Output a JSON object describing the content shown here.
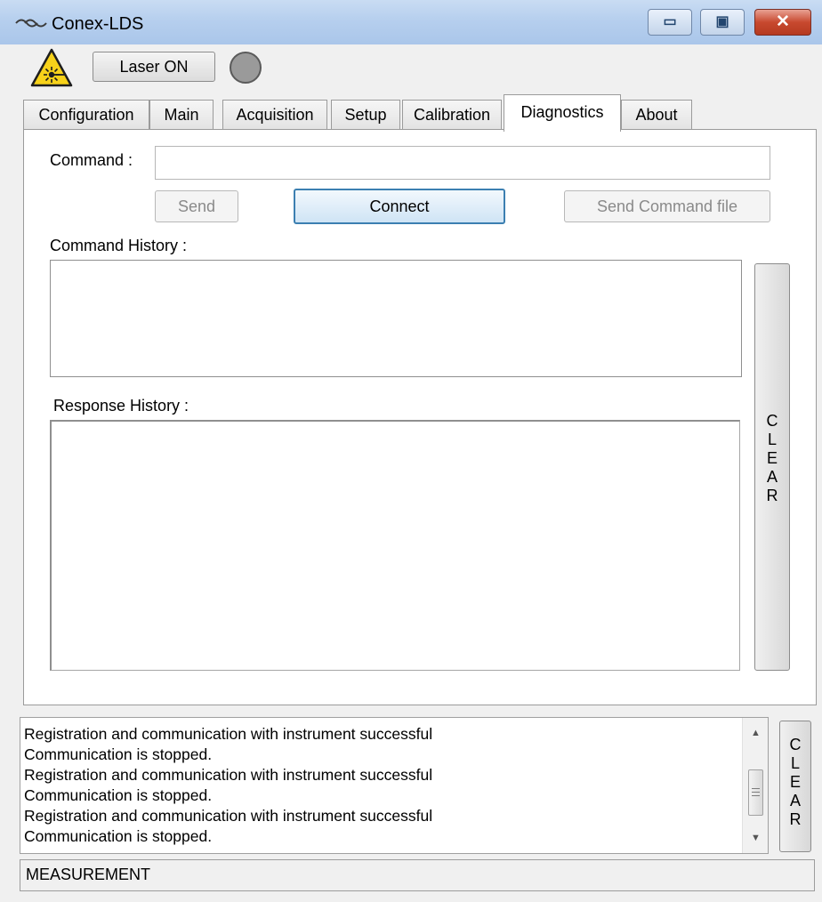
{
  "window": {
    "title": "Conex-LDS",
    "minimize_icon": "minimize-icon",
    "maximize_icon": "maximize-icon",
    "close_icon": "close-icon",
    "minimize_glyph": "▭",
    "maximize_glyph": "▣",
    "close_glyph": "✕"
  },
  "toolbar": {
    "laser_button_label": "Laser ON",
    "laser_icon": "laser-warning-icon",
    "indicator_color": "#9a9a9a"
  },
  "tabs": [
    {
      "label": "Configuration"
    },
    {
      "label": "Main"
    },
    {
      "label": "Acquisition"
    },
    {
      "label": "Setup"
    },
    {
      "label": "Calibration"
    },
    {
      "label": "Diagnostics",
      "active": true
    },
    {
      "label": "About"
    }
  ],
  "diagnostics": {
    "command_label": "Command :",
    "command_value": "",
    "send_label": "Send",
    "connect_label": "Connect",
    "send_file_label": "Send Command file",
    "command_history_label": "Command History :",
    "response_history_label": "Response History :",
    "clear_label": "CLEAR",
    "clear_letters": [
      "C",
      "L",
      "E",
      "A",
      "R"
    ]
  },
  "log": {
    "lines": [
      "Registration and communication with instrument successful",
      "Communication is stopped.",
      "Registration and communication with instrument successful",
      "Communication is stopped.",
      "Registration and communication with instrument successful",
      "Communication is stopped."
    ],
    "clear_letters": [
      "C",
      "L",
      "E",
      "A",
      "R"
    ],
    "scroll_up_icon": "scroll-up-arrow-icon",
    "scroll_down_icon": "scroll-down-arrow-icon",
    "scroll_up_glyph": "▲",
    "scroll_down_glyph": "▼"
  },
  "status": {
    "text": "MEASUREMENT"
  }
}
